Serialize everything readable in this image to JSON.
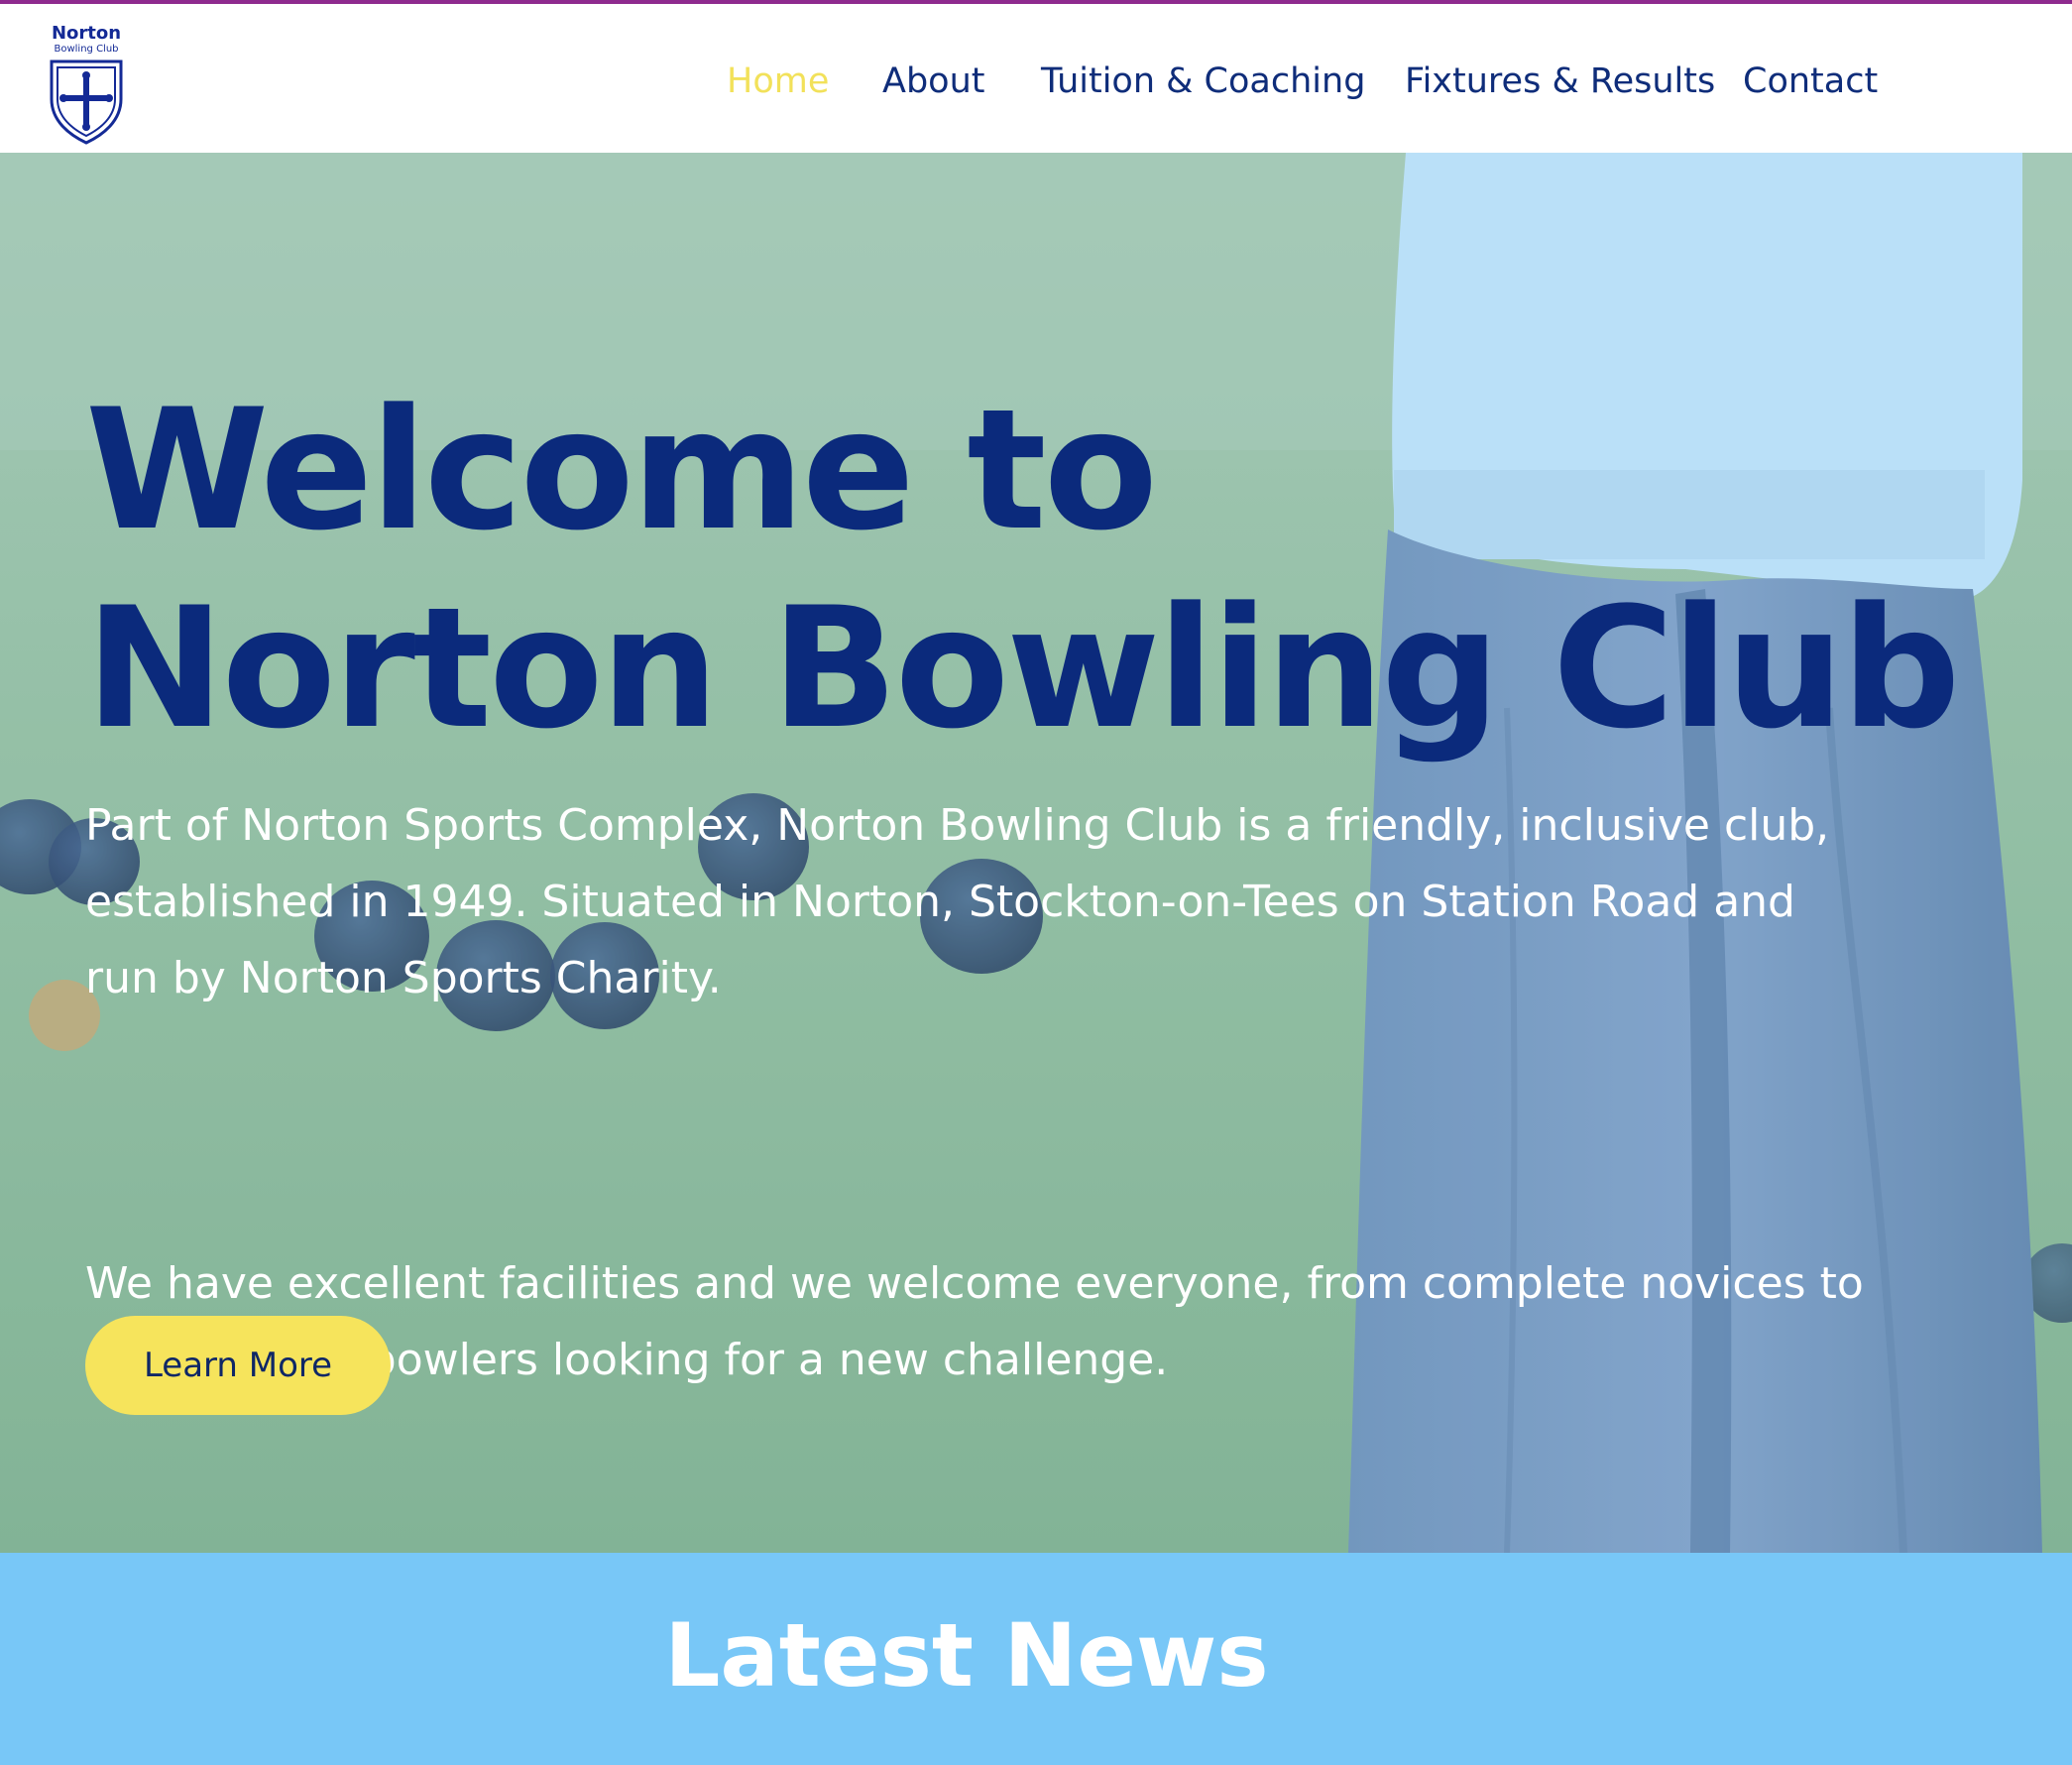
{
  "header": {
    "logo": {
      "title": "Norton",
      "subtitle": "Bowling Club"
    },
    "nav": [
      {
        "label": "Home",
        "active": true
      },
      {
        "label": "About",
        "active": false
      },
      {
        "label": "Tuition & Coaching",
        "active": false
      },
      {
        "label": "Fixtures & Results",
        "active": false
      },
      {
        "label": "Contact",
        "active": false
      }
    ]
  },
  "hero": {
    "title_line1": "Welcome to",
    "title_line2": "Norton Bowling Club",
    "paragraph1": "Part of Norton Sports Complex, Norton Bowling Club is a friendly, inclusive club, established in 1949. Situated in Norton, Stockton-on-Tees on Station Road and run by Norton Sports Charity.",
    "paragraph2": "We have excellent facilities and we welcome everyone, from complete novices to experienced bowlers looking for a new challenge.",
    "cta_label": "Learn More"
  },
  "news": {
    "title": "Latest News"
  },
  "colors": {
    "navy": "#0b2a7c",
    "nav_active": "#f2e15a",
    "cta_bg": "#f6e45c",
    "news_bg": "#78c7f7",
    "top_border": "#8e2a8e"
  }
}
